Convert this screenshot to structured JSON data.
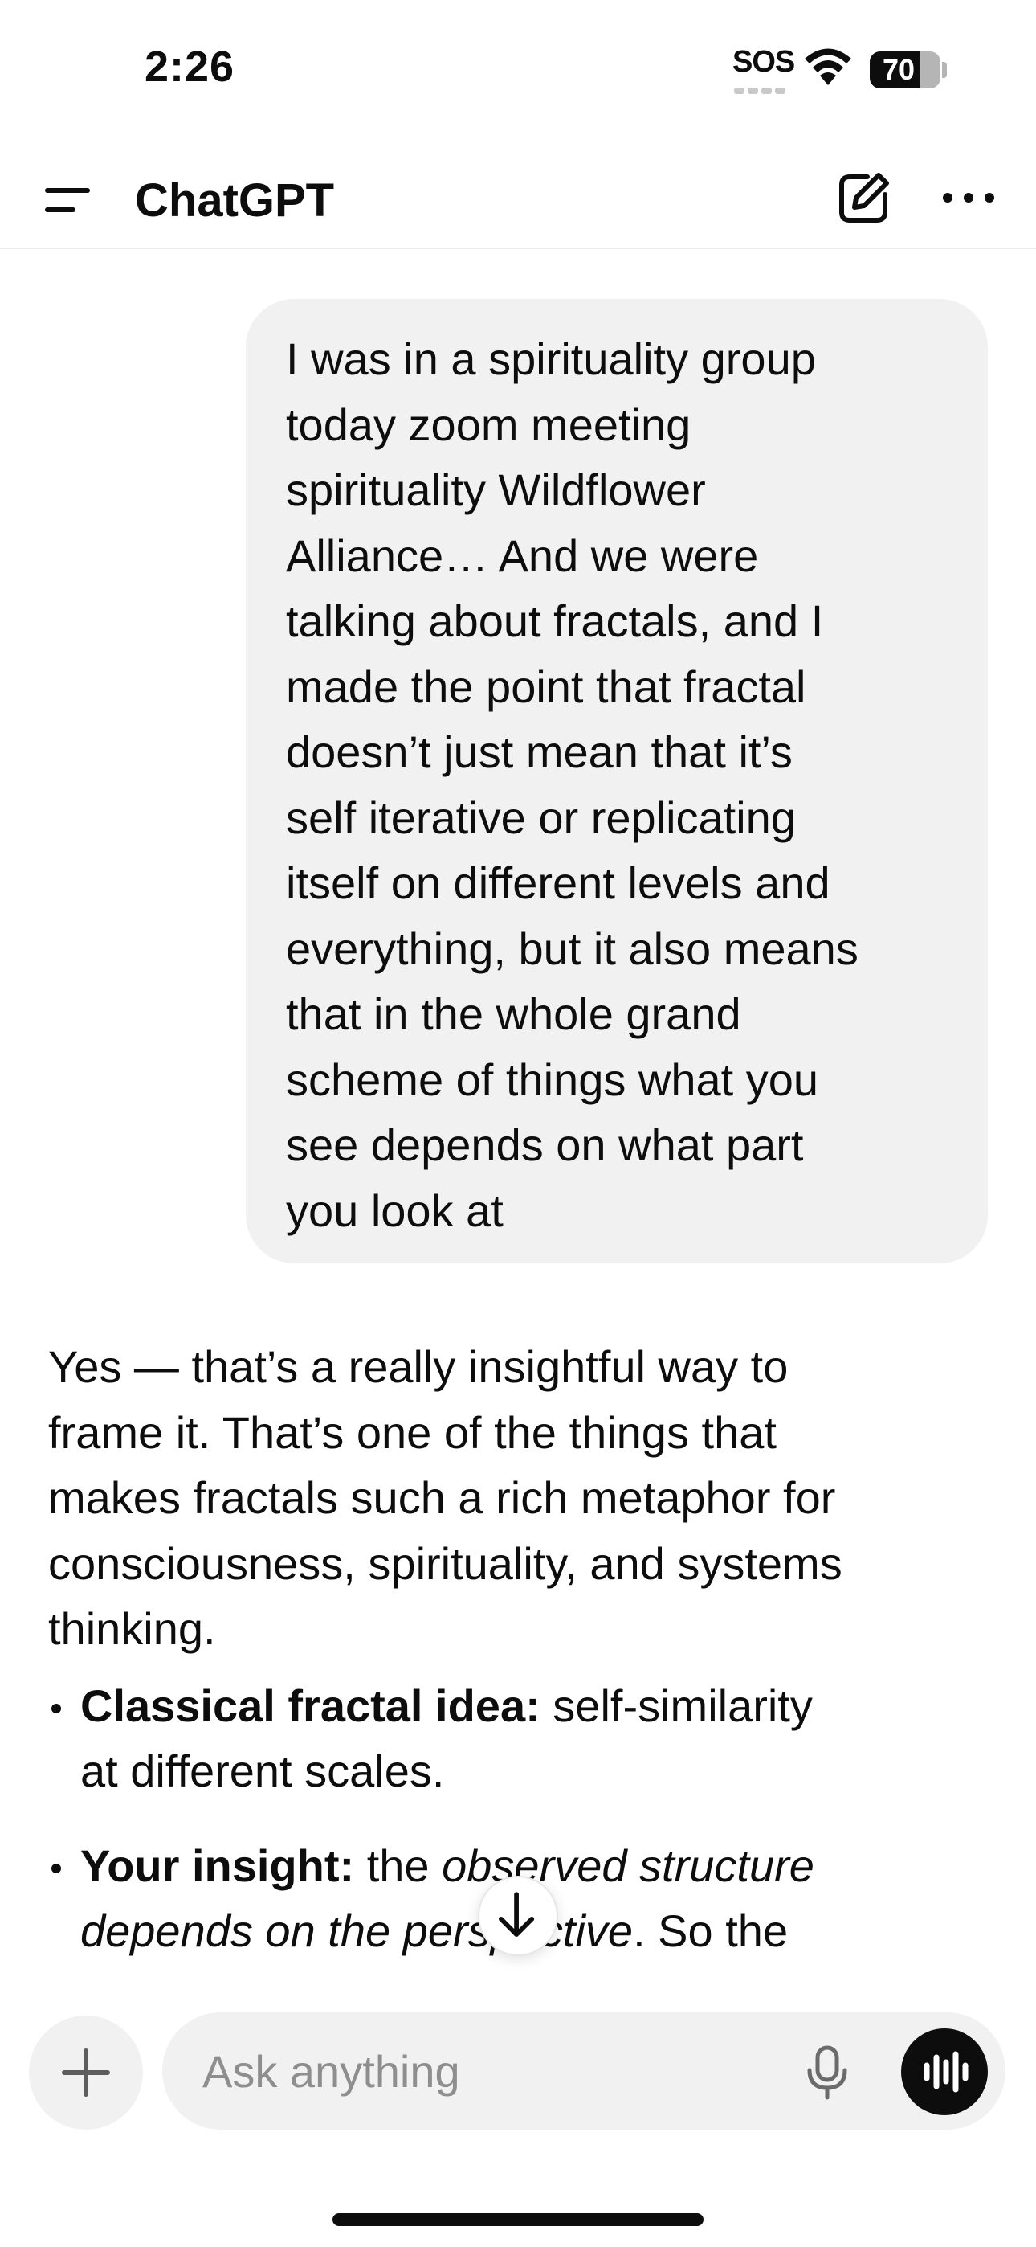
{
  "status_bar": {
    "time": "2:26",
    "sos": "SOS",
    "battery_percent": 70,
    "battery_label": "70",
    "icons": [
      "wifi-icon",
      "battery-icon"
    ]
  },
  "header": {
    "title": "ChatGPT",
    "icons": [
      "menu-icon",
      "compose-icon",
      "more-icon"
    ]
  },
  "conversation": {
    "user_message_lines": [
      "I was in a spirituality group",
      "today zoom meeting",
      "spirituality Wildflower",
      "Alliance… And we were",
      "talking about fractals, and I",
      "made the point that fractal",
      "doesn’t just mean that it’s",
      "self iterative or replicating",
      "itself on different levels and",
      "everything, but it also means",
      "that in the whole grand",
      "scheme of things what you",
      "see depends on what part",
      "you look at"
    ],
    "assistant_lines": [
      "Yes — that’s a really insightful way to",
      "frame it. That’s one of the things that",
      "makes fractals such a rich metaphor for",
      "consciousness, spirituality, and systems",
      "thinking."
    ],
    "bullets": [
      {
        "label": "Classical fractal idea:",
        "text_line1": " self-similarity",
        "text_line2": "at different scales."
      },
      {
        "label": "Your insight:",
        "text_line1_prefix": " the ",
        "text_line1_em": "observed structure",
        "text_line2_em": "depends on the perspective",
        "text_line2_suffix": ". So the"
      }
    ]
  },
  "composer": {
    "placeholder": "Ask anything",
    "icons": [
      "plus-icon",
      "mic-icon",
      "voice-mode-icon"
    ]
  },
  "colors": {
    "bubble_bg": "#f1f1f1",
    "text": "#0d0d0d",
    "placeholder": "#8e8e8e",
    "voice_button": "#0d0d0d"
  }
}
